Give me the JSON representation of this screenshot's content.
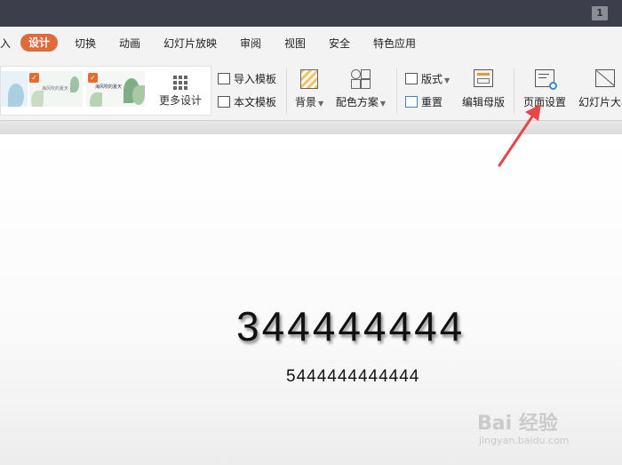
{
  "window": {
    "badge": "1"
  },
  "menu": {
    "items": [
      "入",
      "设计",
      "切换",
      "动画",
      "幻灯片放映",
      "审阅",
      "视图",
      "安全",
      "特色应用"
    ],
    "active": "设计"
  },
  "ribbon": {
    "gallery": {
      "thumb_texts": [
        "海风吹的夏天",
        "海风吹的夏天"
      ],
      "more_label": "更多设计"
    },
    "import_template": "导入模板",
    "this_template": "本文模板",
    "background": "背景",
    "color_scheme": "配色方案",
    "layout": "版式",
    "reset": "重置",
    "edit_master": "编辑母版",
    "page_setup": "页面设置",
    "slide_size": "幻灯片大小"
  },
  "slide": {
    "title": "344444444",
    "subtitle": "5444444444444"
  },
  "watermark": {
    "brand": "Bai 经验",
    "url": "jingyan.baidu.com"
  },
  "colors": {
    "accent": "#e06a3c",
    "arrow": "#e8474a",
    "titlebar": "#3c3f4b"
  }
}
